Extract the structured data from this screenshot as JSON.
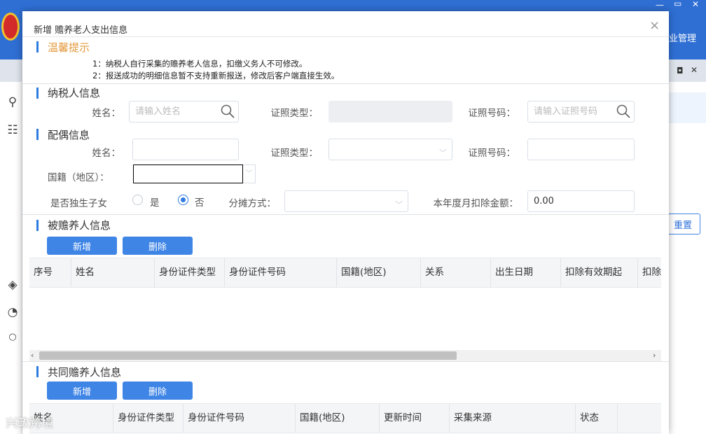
{
  "app": {
    "top_right_label": "业管理",
    "reset_label": "重置"
  },
  "modal": {
    "title": "新增 赡养老人支出信息",
    "close": "×"
  },
  "tips": {
    "heading": "温馨提示",
    "lines": [
      "1：纳税人自行采集的赡养老人信息，扣缴义务人不可修改。",
      "2：报送成功的明细信息暂不支持重新报送，修改后客户端直接生效。"
    ]
  },
  "taxpayer": {
    "heading": "纳税人信息",
    "name_label": "姓名：",
    "name_placeholder": "请输入姓名",
    "id_type_label": "证照类型：",
    "id_type_value": "",
    "id_no_label": "证照号码：",
    "id_no_placeholder": "请输入证照号码"
  },
  "spouse": {
    "heading": "配偶信息",
    "name_label": "姓名：",
    "name_value": "",
    "id_type_label": "证照类型：",
    "id_type_value": "",
    "id_no_label": "证照号码：",
    "id_no_value": "",
    "nationality_label": "国籍（地区）：",
    "nationality_value": "",
    "only_child_label": "是否独生子女",
    "only_child_yes": "是",
    "only_child_no": "否",
    "only_child_selected": "否",
    "share_label": "分摊方式：",
    "share_value": "",
    "monthly_label": "本年度月扣除金额：",
    "monthly_value": "0.00"
  },
  "dependents": {
    "heading": "被赡养人信息",
    "add_label": "新增",
    "delete_label": "删除",
    "columns": [
      "序号",
      "姓名",
      "身份证件类型",
      "身份证件号码",
      "国籍(地区)",
      "关系",
      "出生日期",
      "扣除有效期起",
      "扣除"
    ],
    "rows": []
  },
  "co_supporters": {
    "heading": "共同赡养人信息",
    "add_label": "新增",
    "delete_label": "删除",
    "columns": [
      "姓名",
      "身份证件类型",
      "身份证件号码",
      "国籍(地区)",
      "更新时间",
      "采集来源",
      "状态"
    ],
    "rows": []
  },
  "watermark": "兴政跨境",
  "colors": {
    "accent": "#3f85e6",
    "app_header": "#2f6fd4",
    "tip_heading": "#e39a3c"
  },
  "icons": [
    "national-emblem-icon",
    "user-icon",
    "list-icon",
    "layers-icon",
    "pie-chart-icon",
    "circle-icon",
    "search-icon",
    "chevron-down-icon",
    "close-icon",
    "maximize-icon",
    "minimize-icon"
  ]
}
